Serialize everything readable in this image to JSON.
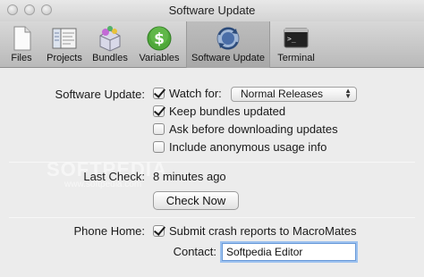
{
  "window": {
    "title": "Software Update"
  },
  "toolbar": {
    "items": [
      {
        "label": "Files",
        "icon": "file-icon"
      },
      {
        "label": "Projects",
        "icon": "projects-icon"
      },
      {
        "label": "Bundles",
        "icon": "bundles-icon"
      },
      {
        "label": "Variables",
        "icon": "dollar-icon"
      },
      {
        "label": "Software Update",
        "icon": "software-update-icon",
        "selected": true
      },
      {
        "label": "Terminal",
        "icon": "terminal-icon"
      }
    ]
  },
  "update": {
    "label": "Software Update:",
    "watch_for_label": "Watch for:",
    "watch_for_checked": true,
    "watch_for_value": "Normal Releases",
    "keep_bundles_label": "Keep bundles updated",
    "keep_bundles_checked": true,
    "ask_before_label": "Ask before downloading updates",
    "ask_before_checked": false,
    "anonymous_label": "Include anonymous usage info",
    "anonymous_checked": false
  },
  "last_check": {
    "label": "Last Check:",
    "value": "8 minutes ago",
    "button": "Check Now"
  },
  "phone_home": {
    "label": "Phone Home:",
    "submit_label": "Submit crash reports to MacroMates",
    "submit_checked": true,
    "contact_label": "Contact:",
    "contact_value": "Softpedia Editor"
  },
  "watermark": {
    "text": "SOFTPEDIA",
    "url": "www.softpedia.com"
  }
}
